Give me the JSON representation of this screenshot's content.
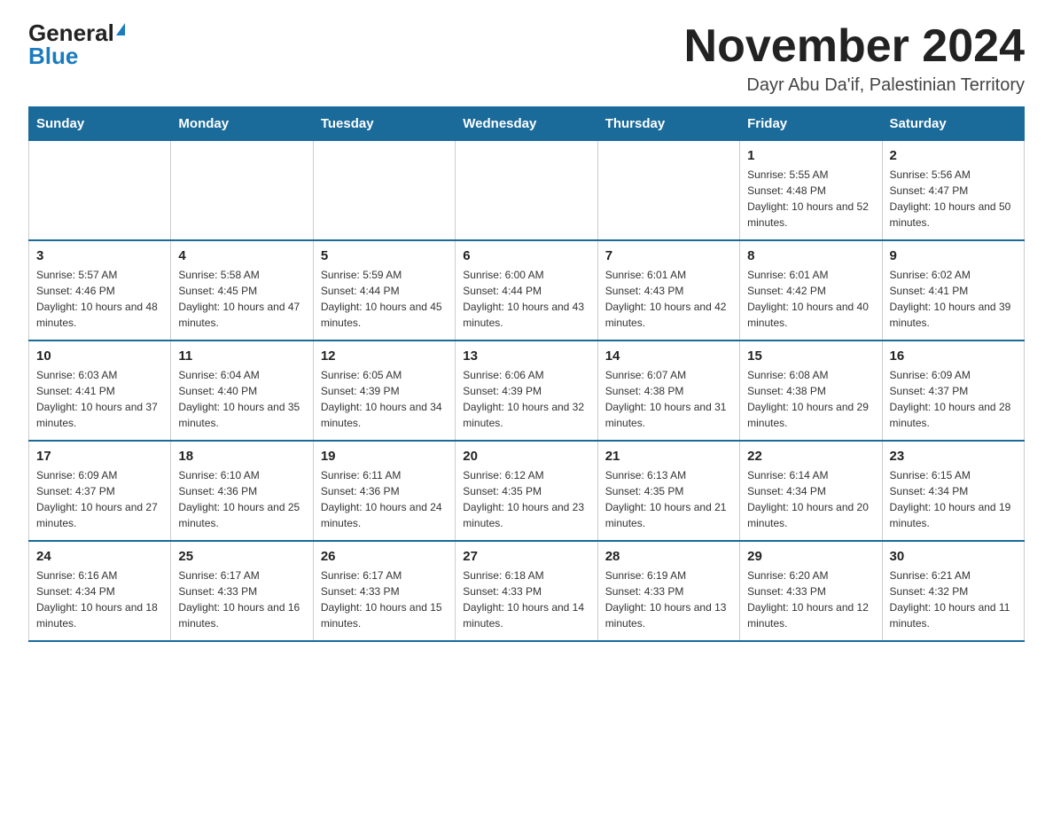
{
  "logo": {
    "general": "General",
    "blue": "Blue"
  },
  "title": "November 2024",
  "subtitle": "Dayr Abu Da'if, Palestinian Territory",
  "weekdays": [
    "Sunday",
    "Monday",
    "Tuesday",
    "Wednesday",
    "Thursday",
    "Friday",
    "Saturday"
  ],
  "weeks": [
    [
      {
        "day": "",
        "info": ""
      },
      {
        "day": "",
        "info": ""
      },
      {
        "day": "",
        "info": ""
      },
      {
        "day": "",
        "info": ""
      },
      {
        "day": "",
        "info": ""
      },
      {
        "day": "1",
        "info": "Sunrise: 5:55 AM\nSunset: 4:48 PM\nDaylight: 10 hours and 52 minutes."
      },
      {
        "day": "2",
        "info": "Sunrise: 5:56 AM\nSunset: 4:47 PM\nDaylight: 10 hours and 50 minutes."
      }
    ],
    [
      {
        "day": "3",
        "info": "Sunrise: 5:57 AM\nSunset: 4:46 PM\nDaylight: 10 hours and 48 minutes."
      },
      {
        "day": "4",
        "info": "Sunrise: 5:58 AM\nSunset: 4:45 PM\nDaylight: 10 hours and 47 minutes."
      },
      {
        "day": "5",
        "info": "Sunrise: 5:59 AM\nSunset: 4:44 PM\nDaylight: 10 hours and 45 minutes."
      },
      {
        "day": "6",
        "info": "Sunrise: 6:00 AM\nSunset: 4:44 PM\nDaylight: 10 hours and 43 minutes."
      },
      {
        "day": "7",
        "info": "Sunrise: 6:01 AM\nSunset: 4:43 PM\nDaylight: 10 hours and 42 minutes."
      },
      {
        "day": "8",
        "info": "Sunrise: 6:01 AM\nSunset: 4:42 PM\nDaylight: 10 hours and 40 minutes."
      },
      {
        "day": "9",
        "info": "Sunrise: 6:02 AM\nSunset: 4:41 PM\nDaylight: 10 hours and 39 minutes."
      }
    ],
    [
      {
        "day": "10",
        "info": "Sunrise: 6:03 AM\nSunset: 4:41 PM\nDaylight: 10 hours and 37 minutes."
      },
      {
        "day": "11",
        "info": "Sunrise: 6:04 AM\nSunset: 4:40 PM\nDaylight: 10 hours and 35 minutes."
      },
      {
        "day": "12",
        "info": "Sunrise: 6:05 AM\nSunset: 4:39 PM\nDaylight: 10 hours and 34 minutes."
      },
      {
        "day": "13",
        "info": "Sunrise: 6:06 AM\nSunset: 4:39 PM\nDaylight: 10 hours and 32 minutes."
      },
      {
        "day": "14",
        "info": "Sunrise: 6:07 AM\nSunset: 4:38 PM\nDaylight: 10 hours and 31 minutes."
      },
      {
        "day": "15",
        "info": "Sunrise: 6:08 AM\nSunset: 4:38 PM\nDaylight: 10 hours and 29 minutes."
      },
      {
        "day": "16",
        "info": "Sunrise: 6:09 AM\nSunset: 4:37 PM\nDaylight: 10 hours and 28 minutes."
      }
    ],
    [
      {
        "day": "17",
        "info": "Sunrise: 6:09 AM\nSunset: 4:37 PM\nDaylight: 10 hours and 27 minutes."
      },
      {
        "day": "18",
        "info": "Sunrise: 6:10 AM\nSunset: 4:36 PM\nDaylight: 10 hours and 25 minutes."
      },
      {
        "day": "19",
        "info": "Sunrise: 6:11 AM\nSunset: 4:36 PM\nDaylight: 10 hours and 24 minutes."
      },
      {
        "day": "20",
        "info": "Sunrise: 6:12 AM\nSunset: 4:35 PM\nDaylight: 10 hours and 23 minutes."
      },
      {
        "day": "21",
        "info": "Sunrise: 6:13 AM\nSunset: 4:35 PM\nDaylight: 10 hours and 21 minutes."
      },
      {
        "day": "22",
        "info": "Sunrise: 6:14 AM\nSunset: 4:34 PM\nDaylight: 10 hours and 20 minutes."
      },
      {
        "day": "23",
        "info": "Sunrise: 6:15 AM\nSunset: 4:34 PM\nDaylight: 10 hours and 19 minutes."
      }
    ],
    [
      {
        "day": "24",
        "info": "Sunrise: 6:16 AM\nSunset: 4:34 PM\nDaylight: 10 hours and 18 minutes."
      },
      {
        "day": "25",
        "info": "Sunrise: 6:17 AM\nSunset: 4:33 PM\nDaylight: 10 hours and 16 minutes."
      },
      {
        "day": "26",
        "info": "Sunrise: 6:17 AM\nSunset: 4:33 PM\nDaylight: 10 hours and 15 minutes."
      },
      {
        "day": "27",
        "info": "Sunrise: 6:18 AM\nSunset: 4:33 PM\nDaylight: 10 hours and 14 minutes."
      },
      {
        "day": "28",
        "info": "Sunrise: 6:19 AM\nSunset: 4:33 PM\nDaylight: 10 hours and 13 minutes."
      },
      {
        "day": "29",
        "info": "Sunrise: 6:20 AM\nSunset: 4:33 PM\nDaylight: 10 hours and 12 minutes."
      },
      {
        "day": "30",
        "info": "Sunrise: 6:21 AM\nSunset: 4:32 PM\nDaylight: 10 hours and 11 minutes."
      }
    ]
  ]
}
